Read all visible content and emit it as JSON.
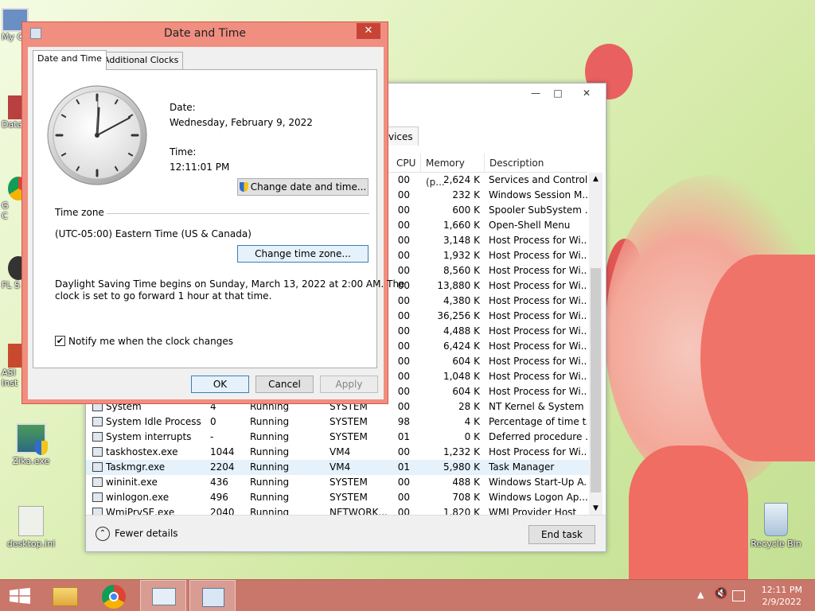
{
  "desktop": {
    "icons": [
      {
        "label": "My C"
      },
      {
        "label": "Data"
      },
      {
        "label": "G\nC"
      },
      {
        "label": "FL S"
      },
      {
        "label": "ASI\nInst"
      },
      {
        "label": "Zika.exe"
      },
      {
        "label": "desktop.ini"
      },
      {
        "label": "Recycle Bin"
      }
    ]
  },
  "taskmgr": {
    "tab_partial": "vices",
    "columns": {
      "cpu": "CPU",
      "memory": "Memory (p...",
      "description": "Description"
    },
    "rows": [
      {
        "name": "",
        "pid": "",
        "status": "",
        "user": "",
        "cpu": "00",
        "mem": "2,624 K",
        "desc": "Services and Control..."
      },
      {
        "name": "",
        "pid": "",
        "status": "",
        "user": "",
        "cpu": "00",
        "mem": "232 K",
        "desc": "Windows Session M..."
      },
      {
        "name": "",
        "pid": "",
        "status": "",
        "user": "",
        "cpu": "00",
        "mem": "600 K",
        "desc": "Spooler SubSystem ..."
      },
      {
        "name": "",
        "pid": "",
        "status": "",
        "user": "",
        "cpu": "00",
        "mem": "1,660 K",
        "desc": "Open-Shell Menu"
      },
      {
        "name": "",
        "pid": "",
        "status": "",
        "user": "",
        "cpu": "00",
        "mem": "3,148 K",
        "desc": "Host Process for Wi..."
      },
      {
        "name": "",
        "pid": "",
        "status": "",
        "user": "",
        "cpu": "00",
        "mem": "1,932 K",
        "desc": "Host Process for Wi..."
      },
      {
        "name": "",
        "pid": "",
        "status": "",
        "user": "",
        "cpu": "00",
        "mem": "8,560 K",
        "desc": "Host Process for Wi..."
      },
      {
        "name": "",
        "pid": "",
        "status": "",
        "user": "",
        "cpu": "00",
        "mem": "13,880 K",
        "desc": "Host Process for Wi..."
      },
      {
        "name": "",
        "pid": "",
        "status": "",
        "user": "",
        "cpu": "00",
        "mem": "4,380 K",
        "desc": "Host Process for Wi..."
      },
      {
        "name": "",
        "pid": "",
        "status": "",
        "user": "",
        "cpu": "00",
        "mem": "36,256 K",
        "desc": "Host Process for Wi..."
      },
      {
        "name": "",
        "pid": "",
        "status": "",
        "user": "",
        "cpu": "00",
        "mem": "4,488 K",
        "desc": "Host Process for Wi..."
      },
      {
        "name": "",
        "pid": "",
        "status": "",
        "user": "",
        "cpu": "00",
        "mem": "6,424 K",
        "desc": "Host Process for Wi..."
      },
      {
        "name": "",
        "pid": "",
        "status": "",
        "user": "",
        "cpu": "00",
        "mem": "604 K",
        "desc": "Host Process for Wi..."
      },
      {
        "name": "",
        "pid": "",
        "status": "",
        "user": "",
        "cpu": "00",
        "mem": "1,048 K",
        "desc": "Host Process for Wi..."
      },
      {
        "name": "",
        "pid": "",
        "status": "",
        "user": "",
        "cpu": "00",
        "mem": "604 K",
        "desc": "Host Process for Wi..."
      },
      {
        "name": "System",
        "pid": "4",
        "status": "Running",
        "user": "SYSTEM",
        "cpu": "00",
        "mem": "28 K",
        "desc": "NT Kernel & System"
      },
      {
        "name": "System Idle Process",
        "pid": "0",
        "status": "Running",
        "user": "SYSTEM",
        "cpu": "98",
        "mem": "4 K",
        "desc": "Percentage of time t..."
      },
      {
        "name": "System interrupts",
        "pid": "-",
        "status": "Running",
        "user": "SYSTEM",
        "cpu": "01",
        "mem": "0 K",
        "desc": "Deferred procedure ..."
      },
      {
        "name": "taskhostex.exe",
        "pid": "1044",
        "status": "Running",
        "user": "VM4",
        "cpu": "00",
        "mem": "1,232 K",
        "desc": "Host Process for Wi..."
      },
      {
        "name": "Taskmgr.exe",
        "pid": "2204",
        "status": "Running",
        "user": "VM4",
        "cpu": "01",
        "mem": "5,980 K",
        "desc": "Task Manager"
      },
      {
        "name": "wininit.exe",
        "pid": "436",
        "status": "Running",
        "user": "SYSTEM",
        "cpu": "00",
        "mem": "488 K",
        "desc": "Windows Start-Up A..."
      },
      {
        "name": "winlogon.exe",
        "pid": "496",
        "status": "Running",
        "user": "SYSTEM",
        "cpu": "00",
        "mem": "708 K",
        "desc": "Windows Logon Ap..."
      },
      {
        "name": "WmiPrvSE.exe",
        "pid": "2040",
        "status": "Running",
        "user": "NETWORK...",
        "cpu": "00",
        "mem": "1,820 K",
        "desc": "WMI Provider Host"
      }
    ],
    "selected_row": "Taskmgr.exe",
    "fewer_details": "Fewer details",
    "end_task": "End task"
  },
  "dialog": {
    "title": "Date and Time",
    "tabs": [
      "Date and Time",
      "Additional Clocks"
    ],
    "date_label": "Date:",
    "date_value": "Wednesday, February 9, 2022",
    "time_label": "Time:",
    "time_value": "12:11:01 PM",
    "change_datetime_btn": "Change date and time...",
    "timezone_heading": "Time zone",
    "timezone_value": "(UTC-05:00) Eastern Time (US & Canada)",
    "change_tz_btn": "Change time zone...",
    "dst_line1": "Daylight Saving Time begins on Sunday, March 13, 2022 at 2:00 AM. The",
    "dst_line2": "clock is set to go forward 1 hour at that time.",
    "notify_label": "Notify me when the clock changes",
    "notify_checked": true,
    "ok": "OK",
    "cancel": "Cancel",
    "apply": "Apply"
  },
  "taskbar": {
    "time": "12:11 PM",
    "date": "2/9/2022"
  }
}
